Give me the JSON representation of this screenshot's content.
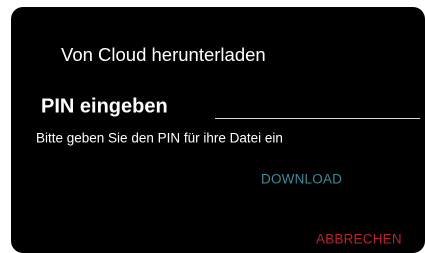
{
  "dialog": {
    "title": "Von Cloud herunterladen",
    "pin_label": "PIN eingeben",
    "pin_input": {
      "value": "",
      "placeholder": ""
    },
    "instruction": "Bitte geben Sie den PIN für ihre Datei ein",
    "download_label": "DOWNLOAD",
    "cancel_label": "ABBRECHEN"
  },
  "colors": {
    "dialog_background": "#000000",
    "text": "#ffffff",
    "download_accent": "#3f8a96",
    "cancel_accent": "#b3262f",
    "input_underline": "#d9d9d9"
  }
}
